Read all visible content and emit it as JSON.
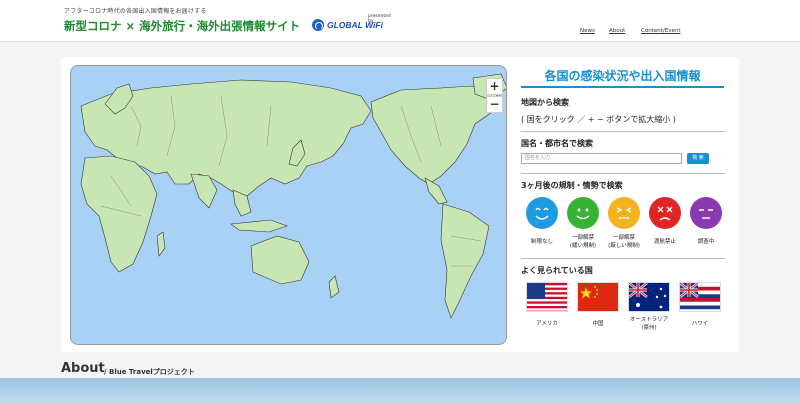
{
  "header": {
    "tagline": "アフターコロナ時代の各国出入国情報をお届けする",
    "site_title": "新型コロナ × 海外旅行・海外出張情報サイト",
    "presented_by": "presented by",
    "logo_text": "GLOBAL WiFi",
    "nav": [
      "News",
      "About",
      "Content/Event"
    ]
  },
  "map": {
    "zoom_in": "+",
    "zoom_out": "−",
    "colors": {
      "land": "#c8e6b4",
      "ocean": "#a9d1f5",
      "border": "#333333"
    }
  },
  "side": {
    "title": "各国の感染状況や出入国情報",
    "map_search": {
      "heading": "地図から検索",
      "note": "( 国をクリック ／ + − ボタンで拡大縮小 )"
    },
    "name_search": {
      "heading": "国名・都市名で検索",
      "placeholder": "国名を入力",
      "button": "検 索"
    },
    "forecast": {
      "heading": "3ヶ月後の規制・情勢で検索",
      "items": [
        {
          "label1": "制限なし",
          "label2": "",
          "color": "#1e9be0",
          "face": "happy"
        },
        {
          "label1": "一部解禁",
          "label2": "(緩い規制)",
          "color": "#36b336",
          "face": "smile"
        },
        {
          "label1": "一部解禁",
          "label2": "(厳しい規制)",
          "color": "#f5b21f",
          "face": "meh"
        },
        {
          "label1": "渡航禁止",
          "label2": "",
          "color": "#e02525",
          "face": "cross"
        },
        {
          "label1": "調査中",
          "label2": "",
          "color": "#8a3ab0",
          "face": "sleepy"
        }
      ]
    },
    "popular": {
      "heading": "よく見られている国",
      "countries": [
        {
          "label1": "アメリカ",
          "label2": "",
          "flag": "us-flag-icon"
        },
        {
          "label1": "中国",
          "label2": "",
          "flag": "china-flag-icon"
        },
        {
          "label1": "オーストラリア",
          "label2": "(豪州)",
          "flag": "australia-flag-icon"
        },
        {
          "label1": "ハワイ",
          "label2": "",
          "flag": "hawaii-flag-icon"
        }
      ]
    }
  },
  "about": {
    "heading": "About",
    "subheading": "/ Blue Travelプロジェクト"
  }
}
